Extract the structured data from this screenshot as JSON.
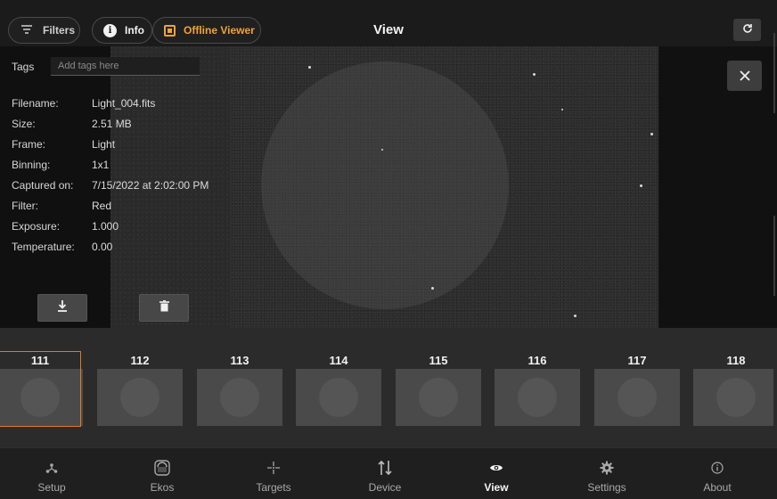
{
  "header": {
    "filters_label": "Filters",
    "info_label": "Info",
    "offline_viewer_label": "Offline Viewer",
    "title": "View",
    "icons": {
      "filters": "filter-icon",
      "info": "info-icon",
      "offline": "image-icon",
      "refresh": "refresh-icon"
    }
  },
  "info": {
    "tags_label": "Tags",
    "tags_placeholder": "Add tags here",
    "fields": [
      {
        "key": "Filename:",
        "value": "Light_004.fits"
      },
      {
        "key": "Size:",
        "value": "2.51 MB"
      },
      {
        "key": "Frame:",
        "value": "Light"
      },
      {
        "key": "Binning:",
        "value": "1x1"
      },
      {
        "key": "Captured on:",
        "value": "7/15/2022 at 2:02:00 PM"
      },
      {
        "key": "Filter:",
        "value": "Red"
      },
      {
        "key": "Exposure:",
        "value": "1.000"
      },
      {
        "key": "Temperature:",
        "value": "0.00"
      }
    ],
    "icons": {
      "download": "download-icon",
      "delete": "trash-icon",
      "close": "close-icon"
    }
  },
  "thumbnails": [
    "111",
    "112",
    "113",
    "114",
    "115",
    "116",
    "117",
    "118"
  ],
  "selected_thumbnail": "111",
  "nav": [
    {
      "label": "Setup",
      "icon": "setup-icon"
    },
    {
      "label": "Ekos",
      "icon": "ekos-icon"
    },
    {
      "label": "Targets",
      "icon": "targets-icon"
    },
    {
      "label": "Device",
      "icon": "device-icon"
    },
    {
      "label": "View",
      "icon": "eye-icon",
      "active": true
    },
    {
      "label": "Settings",
      "icon": "gear-icon"
    },
    {
      "label": "About",
      "icon": "about-icon"
    }
  ],
  "colors": {
    "accent": "#f0a23a",
    "selected_border": "#e07a2a",
    "background": "#1b1b1b"
  }
}
